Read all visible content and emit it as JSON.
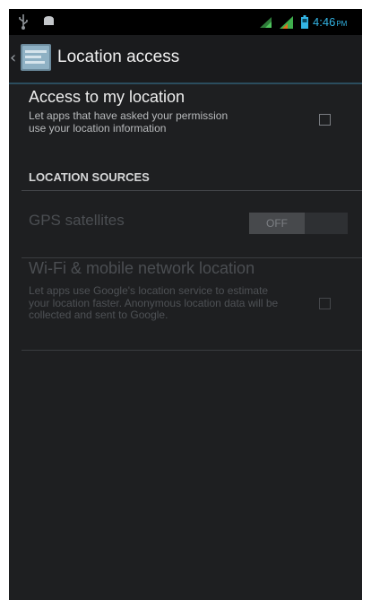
{
  "status_bar": {
    "time": "4:46",
    "ampm": "PM",
    "icons": [
      "usb-icon",
      "notification-icon",
      "signal-icon",
      "signal-icon",
      "battery-icon"
    ]
  },
  "action_bar": {
    "title": "Location access",
    "icon": "settings-app-icon"
  },
  "preferences": {
    "access_location": {
      "title": "Access to my location",
      "summary": "Let apps that have asked your permission use your location information",
      "checked": false
    },
    "section_header": "LOCATION SOURCES",
    "gps": {
      "title": "GPS satellites",
      "toggle_label": "OFF",
      "enabled": false
    },
    "wifi_mobile": {
      "title": "Wi-Fi & mobile network location",
      "summary": "Let apps use Google's location service to estimate your location faster. Anonymous location data will be collected and sent to Google.",
      "checked": false,
      "enabled": false
    }
  },
  "colors": {
    "accent": "#33b5e5",
    "background": "#1e1f21",
    "disabled_text": "#4b4e52"
  }
}
